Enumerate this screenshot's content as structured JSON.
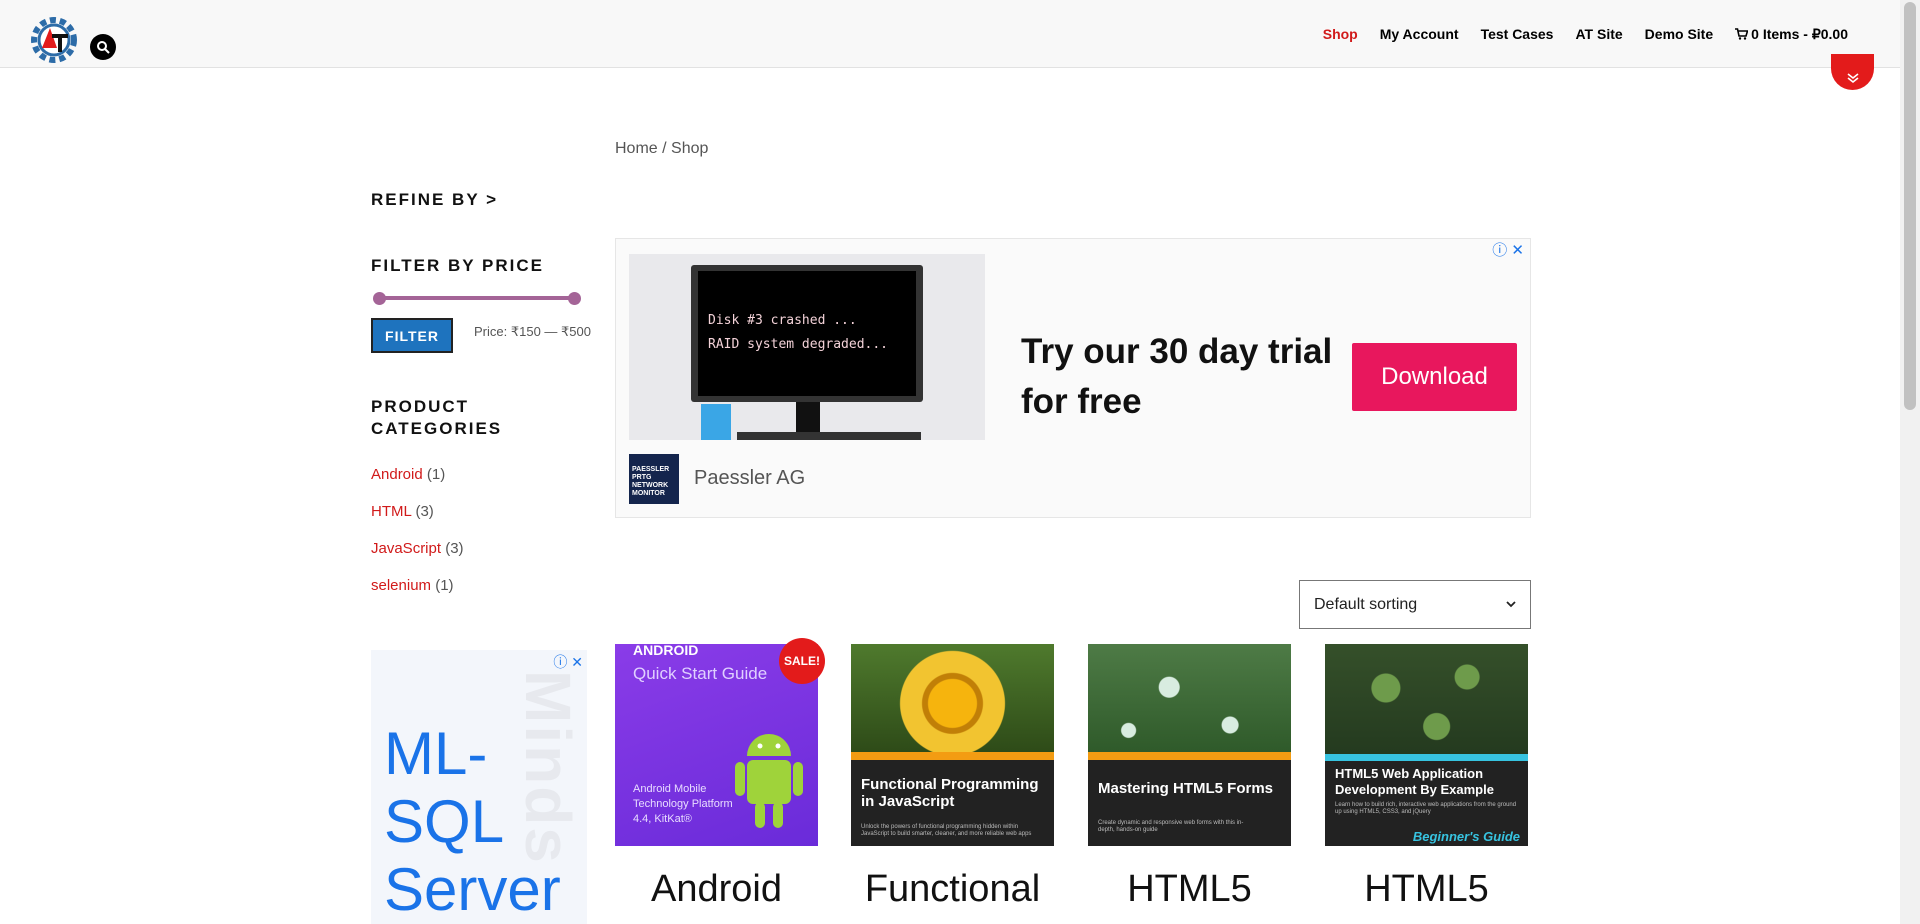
{
  "header": {
    "nav": [
      "Shop",
      "My Account",
      "Test Cases",
      "AT Site",
      "Demo Site"
    ],
    "cart": "0 Items - ₽0.00",
    "accent": "#d11a1a"
  },
  "breadcrumb": {
    "home": "Home",
    "sep": " / ",
    "current": "Shop"
  },
  "sidebar": {
    "refine": "REFINE BY >",
    "filter_title": "FILTER BY PRICE",
    "filter_button": "FILTER",
    "price_label": "Price: ₹150 — ₹500",
    "categories_title": "PRODUCT CATEGORIES",
    "categories": [
      {
        "name": "Android",
        "count": "(1)"
      },
      {
        "name": "HTML",
        "count": "(3)"
      },
      {
        "name": "JavaScript",
        "count": "(3)"
      },
      {
        "name": "selenium",
        "count": "(1)"
      }
    ]
  },
  "side_ad": {
    "text": "ML-SQL Server",
    "ghost": "Minds"
  },
  "ad": {
    "screen_line1": "Disk #3 crashed ...",
    "screen_line2": "RAID system degraded...",
    "logo_text": "PAESSLER PRTG NETWORK MONITOR",
    "brand": "Paessler AG",
    "headline": "Try our 30 day trial for free",
    "cta": "Download",
    "cta_color": "#e8175d"
  },
  "sorting": {
    "selected": "Default sorting"
  },
  "products": [
    {
      "title": "Android",
      "sale": "SALE!",
      "cover_line1": "ANDROID",
      "cover_line2": "Quick Start Guide",
      "cover_line3": "Android Mobile Technology Platform 4.4, KitKat®"
    },
    {
      "title": "Functional",
      "cover_title": "Functional Programming in JavaScript",
      "cover_sub": "Unlock the powers of functional programming hidden within JavaScript to build smarter, cleaner, and more reliable web apps"
    },
    {
      "title": "HTML5",
      "cover_title": "Mastering HTML5 Forms",
      "cover_sub": "Create dynamic and responsive web forms with this in-depth, hands-on guide"
    },
    {
      "title": "HTML5",
      "cover_title": "HTML5 Web Application Development By Example",
      "cover_sub": "Learn how to build rich, interactive web applications from the ground up using HTML5, CSS3, and jQuery",
      "cover_guide": "Beginner's Guide"
    }
  ]
}
